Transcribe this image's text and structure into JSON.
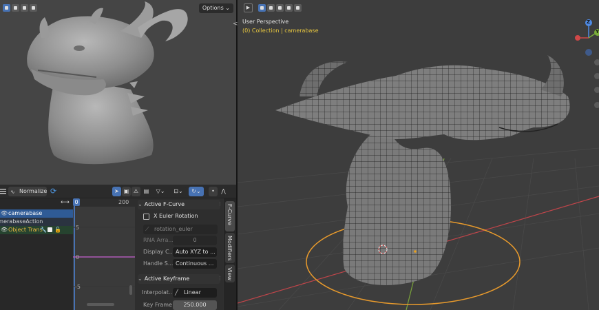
{
  "render": {
    "options_label": "Options ⌄"
  },
  "graph": {
    "normalize_label": "Normalize",
    "frame_current": "0",
    "frame_end": "200",
    "channels": [
      {
        "label": "camerabase",
        "selected": true
      },
      {
        "label": "camerabaseAction",
        "selected": false
      },
      {
        "label": "Object Trans",
        "selected": false
      }
    ],
    "y_ticks": [
      "5",
      "0",
      "-5"
    ],
    "panel": {
      "active_fcurve": "Active F-Curve",
      "channel_name": "X Euler Rotation",
      "rna_path": "rotation_euler",
      "rna_array_label": "RNA Arra...",
      "rna_array_value": "0",
      "display_color_label": "Display C...",
      "display_color_value": "Auto XYZ to ...",
      "handle_smoothing_label": "Handle S...",
      "handle_smoothing_value": "Continuous ...",
      "active_keyframe": "Active Keyframe",
      "interpolation_label": "Interpolat...",
      "interpolation_value": "Linear",
      "key_frame_label": "Key Frame",
      "key_frame_value": "250.000"
    },
    "tabs": [
      "F-Curve",
      "Modifiers",
      "View"
    ]
  },
  "viewport": {
    "perspective_label": "User Perspective",
    "collection_label": "(0) Collection | camerabase",
    "gizmo_z": "Z",
    "gizmo_y": "Y"
  },
  "colors": {
    "accent": "#4772b3",
    "collection": "#e8c840",
    "curve": "#b05ab8",
    "orbit": "#e89a2c"
  }
}
